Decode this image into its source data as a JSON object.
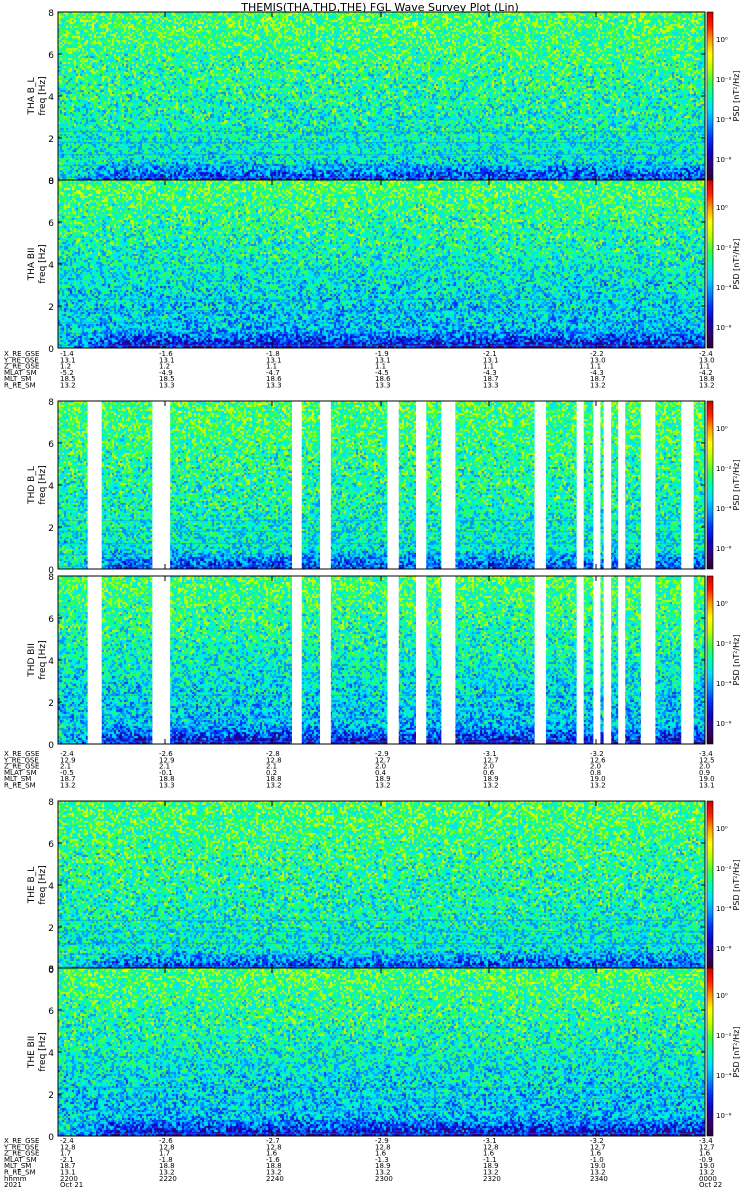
{
  "chart_data": {
    "type": "heatmap",
    "title": "THEMIS(THA,THD,THE) FGL Wave Survey Plot (Lin)",
    "panels": [
      {
        "id": "tha-bl",
        "ylabel": "THA B_L",
        "yunit": "freq [Hz]",
        "ylim": [
          0,
          8
        ],
        "yticks": [
          "0",
          "2",
          "4",
          "6",
          "8"
        ],
        "zlabel": "PSD [nT²/Hz]",
        "zticks": [
          "10⁰",
          "10⁻²",
          "10⁻⁴",
          "10⁻⁶"
        ],
        "gaps": []
      },
      {
        "id": "tha-bii",
        "ylabel": "THA BII",
        "yunit": "freq [Hz]",
        "ylim": [
          0,
          8
        ],
        "yticks": [
          "0",
          "2",
          "4",
          "6",
          "8"
        ],
        "zlabel": "PSD [nT²/Hz]",
        "zticks": [
          "10⁰",
          "10⁻²",
          "10⁻⁴",
          "10⁻⁶"
        ],
        "gaps": []
      },
      {
        "id": "thd-bl",
        "ylabel": "THD B_L",
        "yunit": "freq [Hz]",
        "ylim": [
          0,
          8
        ],
        "yticks": [
          "0",
          "2",
          "4",
          "6",
          "8"
        ],
        "zlabel": "PSD [nT²/Hz]",
        "zticks": [
          "10⁰",
          "10⁻²",
          "10⁻⁴",
          "10⁻⁶"
        ],
        "gaps": [
          [
            2205.5,
            2208.1
          ],
          [
            2217.5,
            2220.8
          ],
          [
            2243.4,
            2245.2
          ],
          [
            2248.6,
            2250.6
          ],
          [
            2301.1,
            2303.2
          ],
          [
            2306.4,
            2308.3
          ],
          [
            2311.1,
            2313.7
          ],
          [
            2328.4,
            2330.5
          ],
          [
            2336.2,
            2337.5
          ],
          [
            2339.3,
            2340.6
          ],
          [
            2341.2,
            2342.6
          ],
          [
            2343.9,
            2345.2
          ],
          [
            2348.1,
            2350.8
          ],
          [
            2355.6,
            2357.9
          ]
        ]
      },
      {
        "id": "thd-bii",
        "ylabel": "THD BII",
        "yunit": "freq [Hz]",
        "ylim": [
          0,
          8
        ],
        "yticks": [
          "0",
          "2",
          "4",
          "6",
          "8"
        ],
        "zlabel": "PSD [nT²/Hz]",
        "zticks": [
          "10⁰",
          "10⁻²",
          "10⁻⁴",
          "10⁻⁶"
        ],
        "gaps": [
          [
            2205.5,
            2208.1
          ],
          [
            2217.5,
            2220.8
          ],
          [
            2243.4,
            2245.2
          ],
          [
            2248.6,
            2250.6
          ],
          [
            2301.1,
            2303.2
          ],
          [
            2306.4,
            2308.3
          ],
          [
            2311.1,
            2313.7
          ],
          [
            2328.4,
            2330.5
          ],
          [
            2336.2,
            2337.5
          ],
          [
            2339.3,
            2340.6
          ],
          [
            2341.2,
            2342.6
          ],
          [
            2343.9,
            2345.2
          ],
          [
            2348.1,
            2350.8
          ],
          [
            2355.6,
            2357.9
          ]
        ]
      },
      {
        "id": "the-bl",
        "ylabel": "THE B_L",
        "yunit": "freq [Hz]",
        "ylim": [
          0,
          8
        ],
        "yticks": [
          "0",
          "2",
          "4",
          "6",
          "8"
        ],
        "zlabel": "PSD [nT²/Hz]",
        "zticks": [
          "10⁰",
          "10⁻²",
          "10⁻⁴",
          "10⁻⁶"
        ],
        "gaps": []
      },
      {
        "id": "the-bii",
        "ylabel": "THE BII",
        "yunit": "freq [Hz]",
        "ylim": [
          0,
          8
        ],
        "yticks": [
          "0",
          "2",
          "4",
          "6",
          "8"
        ],
        "zlabel": "PSD [nT²/Hz]",
        "zticks": [
          "10⁰",
          "10⁻²",
          "10⁻⁴",
          "10⁻⁶"
        ],
        "gaps": []
      }
    ],
    "x": {
      "time_range": [
        "2200",
        "0000"
      ]
    },
    "ephemeris": [
      {
        "labels": [
          "X_RE_GSE",
          "Y_RE_GSE",
          "Z_RE_GSE",
          "MLAT_SM",
          "MLT_SM",
          "R_RE_SM"
        ],
        "columns": [
          [
            "-1.4",
            "13.1",
            "1.2",
            "-5.2",
            "18.5",
            "13.2"
          ],
          [
            "-1.6",
            "13.1",
            "1.2",
            "-4.9",
            "18.5",
            "13.3"
          ],
          [
            "-1.8",
            "13.1",
            "1.1",
            "-4.7",
            "18.6",
            "13.3"
          ],
          [
            "-1.9",
            "13.1",
            "1.1",
            "-4.5",
            "18.6",
            "13.3"
          ],
          [
            "-2.1",
            "13.1",
            "1.1",
            "-4.3",
            "18.7",
            "13.3"
          ],
          [
            "-2.2",
            "13.0",
            "1.1",
            "-4.3",
            "18.7",
            "13.2"
          ],
          [
            "-2.4",
            "13.0",
            "1.1",
            "-4.2",
            "18.8",
            "13.2"
          ]
        ]
      },
      {
        "labels": [
          "X_RE_GSE",
          "Y_RE_GSE",
          "Z_RE_GSE",
          "MLAT_SM",
          "MLT_SM",
          "R_RE_SM"
        ],
        "columns": [
          [
            "-2.4",
            "12.9",
            "2.1",
            "-0.5",
            "18.7",
            "13.2"
          ],
          [
            "-2.6",
            "12.9",
            "2.1",
            "-0.1",
            "18.8",
            "13.3"
          ],
          [
            "-2.8",
            "12.8",
            "2.1",
            "0.2",
            "18.8",
            "13.2"
          ],
          [
            "-2.9",
            "12.7",
            "2.0",
            "0.4",
            "18.9",
            "13.2"
          ],
          [
            "-3.1",
            "12.7",
            "2.0",
            "0.6",
            "18.9",
            "13.2"
          ],
          [
            "-3.2",
            "12.6",
            "2.0",
            "0.8",
            "19.0",
            "13.2"
          ],
          [
            "-3.4",
            "12.5",
            "2.0",
            "0.9",
            "19.0",
            "13.1"
          ]
        ]
      },
      {
        "labels": [
          "X_RE_GSE",
          "Y_RE_GSE",
          "Z_RE_GSE",
          "MLAT_SM",
          "MLT_SM",
          "R_RE_SM",
          "hhmm",
          "2021"
        ],
        "columns": [
          [
            "-2.4",
            "12.8",
            "1.7",
            "-2.1",
            "18.7",
            "13.1",
            "2200",
            "Oct 21"
          ],
          [
            "-2.6",
            "12.8",
            "1.7",
            "-1.8",
            "18.8",
            "13.2",
            "2220",
            ""
          ],
          [
            "-2.7",
            "12.8",
            "1.6",
            "-1.6",
            "18.8",
            "13.2",
            "2240",
            ""
          ],
          [
            "-2.9",
            "12.8",
            "1.6",
            "-1.3",
            "18.9",
            "13.2",
            "2300",
            ""
          ],
          [
            "-3.1",
            "12.8",
            "1.6",
            "-1.1",
            "18.9",
            "13.2",
            "2320",
            ""
          ],
          [
            "-3.2",
            "12.7",
            "1.6",
            "-1.0",
            "19.0",
            "13.2",
            "2340",
            ""
          ],
          [
            "-3.4",
            "12.7",
            "1.6",
            "-0.9",
            "19.0",
            "13.2",
            "0000",
            "Oct 22"
          ]
        ]
      }
    ],
    "colormap": [
      "#2a0032",
      "#300070",
      "#1000c0",
      "#0030ff",
      "#0090ff",
      "#00e0ff",
      "#00ffb0",
      "#40ff40",
      "#c0ff00",
      "#ffff00",
      "#ffa000",
      "#ff2000",
      "#d00000"
    ]
  }
}
